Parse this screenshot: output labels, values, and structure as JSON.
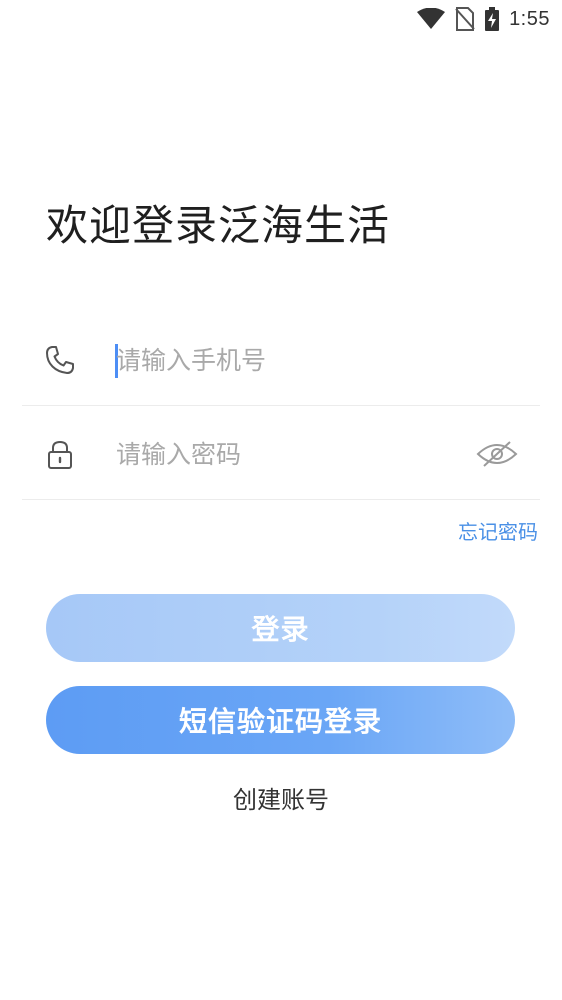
{
  "status_bar": {
    "time": "1:55",
    "icons": [
      "wifi-icon",
      "no-sim-icon",
      "battery-charging-icon"
    ]
  },
  "login": {
    "title": "欢迎登录泛海生活",
    "phone_placeholder": "请输入手机号",
    "password_placeholder": "请输入密码",
    "forgot_password": "忘记密码",
    "login_button": "登录",
    "sms_login_button": "短信验证码登录",
    "create_account": "创建账号"
  },
  "colors": {
    "accent": "#4a90e6",
    "button_primary": "#6aa6f6",
    "button_disabled": "#b4d2f9",
    "placeholder": "#a9a9a9"
  }
}
